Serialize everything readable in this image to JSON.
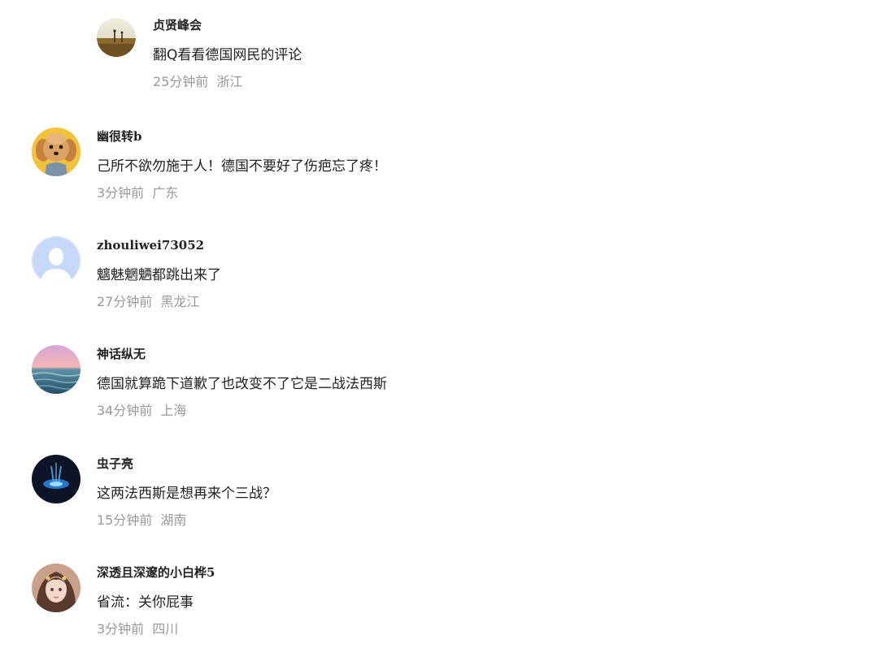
{
  "comments": [
    {
      "username": "贞贤峰会",
      "text": "翻Q看看德国网民的评论",
      "time": "25分钟前",
      "location": "浙江",
      "avatar": "landscape-avatar",
      "is_reply": true
    },
    {
      "username": "幽很转b",
      "text": "己所不欲勿施于人！德国不要好了伤疤忘了疼！",
      "time": "3分钟前",
      "location": "广东",
      "avatar": "dog-avatar"
    },
    {
      "username": "zhouliwei73052",
      "text": "魑魅魍魉都跳出来了",
      "time": "27分钟前",
      "location": "黑龙江",
      "avatar": "default-user-avatar"
    },
    {
      "username": "神话纵无",
      "text": "德国就算跪下道歉了也改变不了它是二战法西斯",
      "time": "34分钟前",
      "location": "上海",
      "avatar": "sea-sunset-avatar"
    },
    {
      "username": "虫子亮",
      "text": "这两法西斯是想再来个三战？",
      "time": "15分钟前",
      "location": "湖南",
      "avatar": "blue-light-avatar"
    },
    {
      "username": "深透且深邃的小白桦5",
      "text": "省流：关你屁事",
      "time": "3分钟前",
      "location": "四川",
      "avatar": "anime-girl-avatar"
    }
  ]
}
